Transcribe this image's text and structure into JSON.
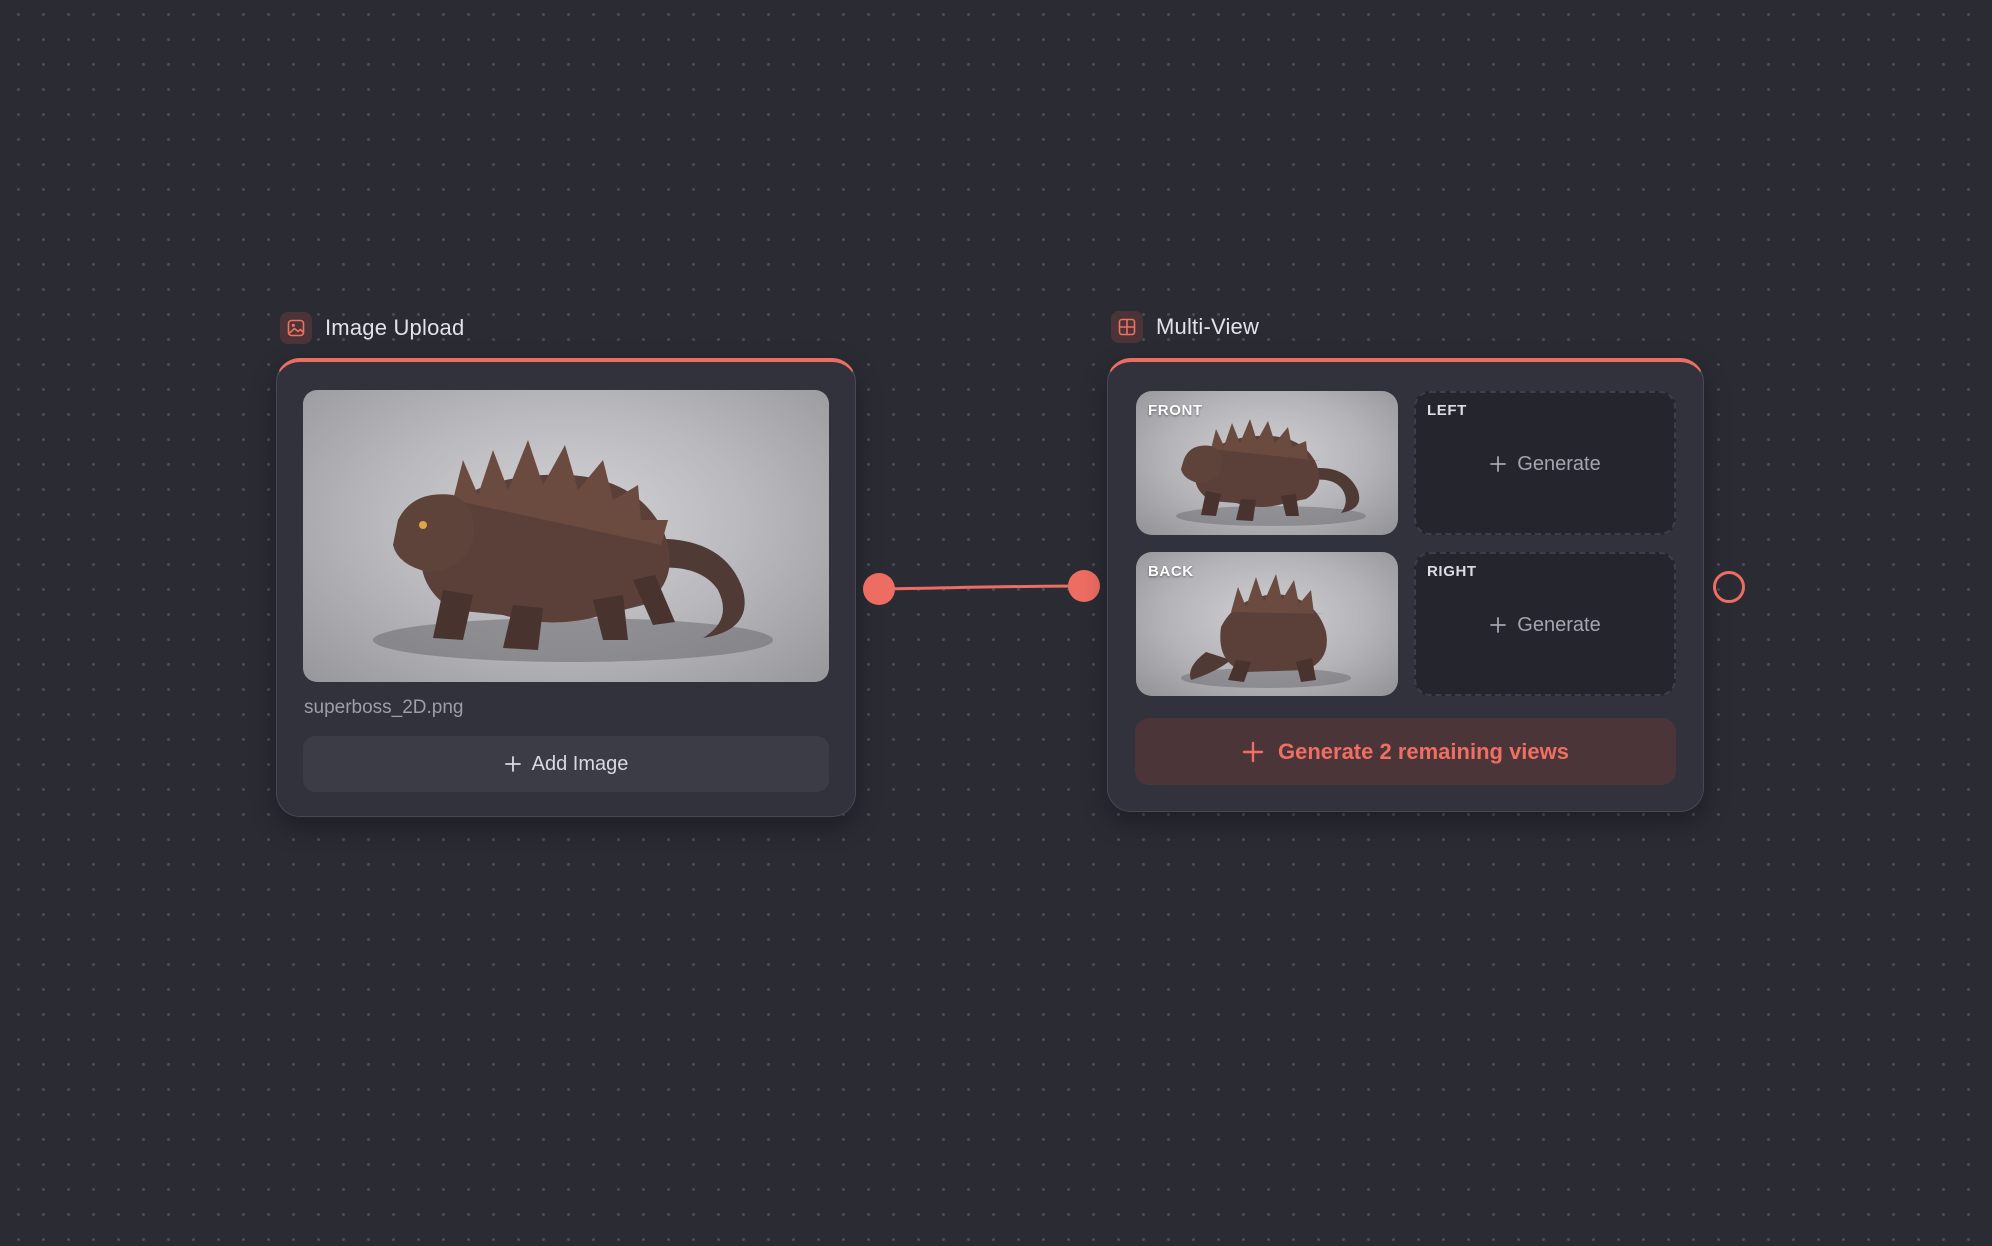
{
  "colors": {
    "canvas_background": "#2a2b33",
    "node_background": "#31323b",
    "accent": "#ea6e62",
    "connection": "#ed6d62"
  },
  "image_upload_node": {
    "title": "Image Upload",
    "icon": "image-icon",
    "preview_subject": "creature",
    "file_name": "superboss_2D.png",
    "add_button_label": "Add Image",
    "add_button_icon": "plus-icon"
  },
  "multiview_node": {
    "title": "Multi-View",
    "icon": "grid-icon",
    "views": [
      {
        "label": "FRONT",
        "state": "generated"
      },
      {
        "label": "LEFT",
        "state": "empty",
        "action_label": "Generate"
      },
      {
        "label": "BACK",
        "state": "generated"
      },
      {
        "label": "RIGHT",
        "state": "empty",
        "action_label": "Generate"
      }
    ],
    "generate_remaining_label": "Generate 2 remaining views",
    "generate_remaining_icon": "plus-icon"
  },
  "connections": [
    {
      "from": "Image Upload",
      "to": "Multi-View"
    }
  ]
}
